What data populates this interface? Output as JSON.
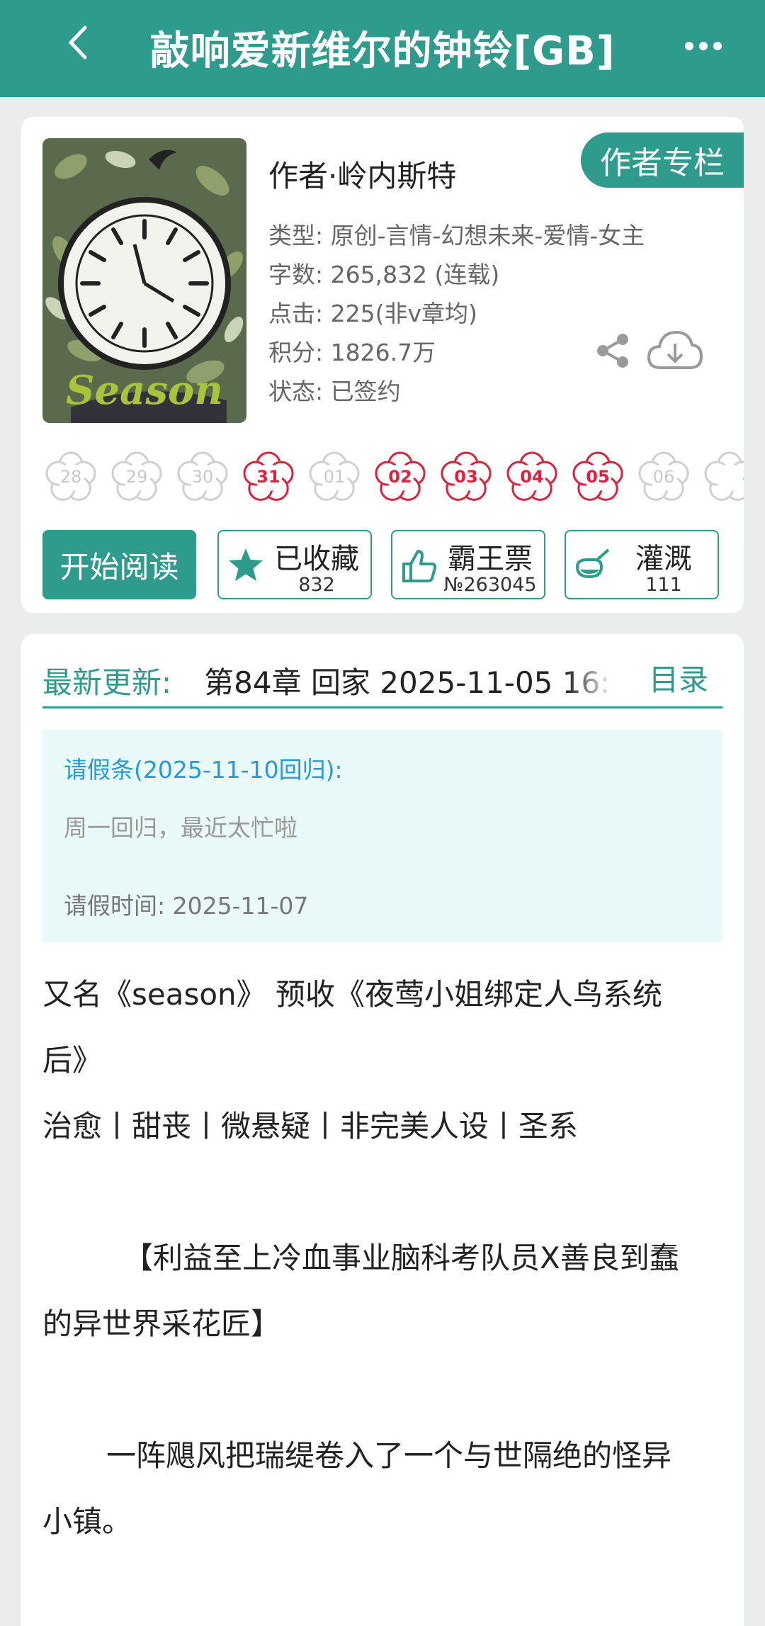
{
  "header": {
    "title": "敲响爱新维尔的钟铃[GB]"
  },
  "book": {
    "cover_text": "Season",
    "author": "作者·岭内斯特",
    "author_column_label": "作者专栏",
    "info": {
      "type": "类型: 原创-言情-幻想未来-爱情-女主",
      "words": "字数: 265,832 (连载)",
      "clicks": "点击: 225(非v章均)",
      "score": "积分: 1826.7万",
      "status": "状态: 已签约"
    }
  },
  "calendar": {
    "days": [
      {
        "label": "28",
        "active": false
      },
      {
        "label": "29",
        "active": false
      },
      {
        "label": "30",
        "active": false
      },
      {
        "label": "31",
        "active": true
      },
      {
        "label": "01",
        "active": false
      },
      {
        "label": "02",
        "active": true
      },
      {
        "label": "03",
        "active": true
      },
      {
        "label": "04",
        "active": true
      },
      {
        "label": "05",
        "active": true
      },
      {
        "label": "06",
        "active": false
      },
      {
        "label": "",
        "active": false
      }
    ]
  },
  "actions": {
    "read_label": "开始阅读",
    "favorite": {
      "label": "已收藏",
      "count": "832"
    },
    "ticket": {
      "label": "霸王票",
      "count": "№263045"
    },
    "water": {
      "label": "灌溉",
      "count": "111"
    }
  },
  "latest": {
    "label": "最新更新:",
    "chapter": "第84章  回家  2025-11-05 16:",
    "toc_label": "目录"
  },
  "leave": {
    "title": "请假条(2025-11-10回归):",
    "reason": "周一回归，最近太忙啦",
    "time": "请假时间:  2025-11-07"
  },
  "description": {
    "line1": "又名《season》  预收《夜莺小姐绑定人鸟系统",
    "line2": "后》",
    "line3": "治愈丨甜丧丨微悬疑丨非完美人设丨圣系",
    "line4": "【利益至上冷血事业脑科考队员X善良到蠢",
    "line5": "的异世界采花匠】",
    "line6": "一阵飓风把瑞缇卷入了一个与世隔绝的怪异",
    "line7": "小镇。"
  },
  "colors": {
    "accent": "#2e9b8c",
    "red": "#e0203a",
    "leave_bg": "#e9f8f8",
    "leave_title": "#2a9ad6"
  }
}
